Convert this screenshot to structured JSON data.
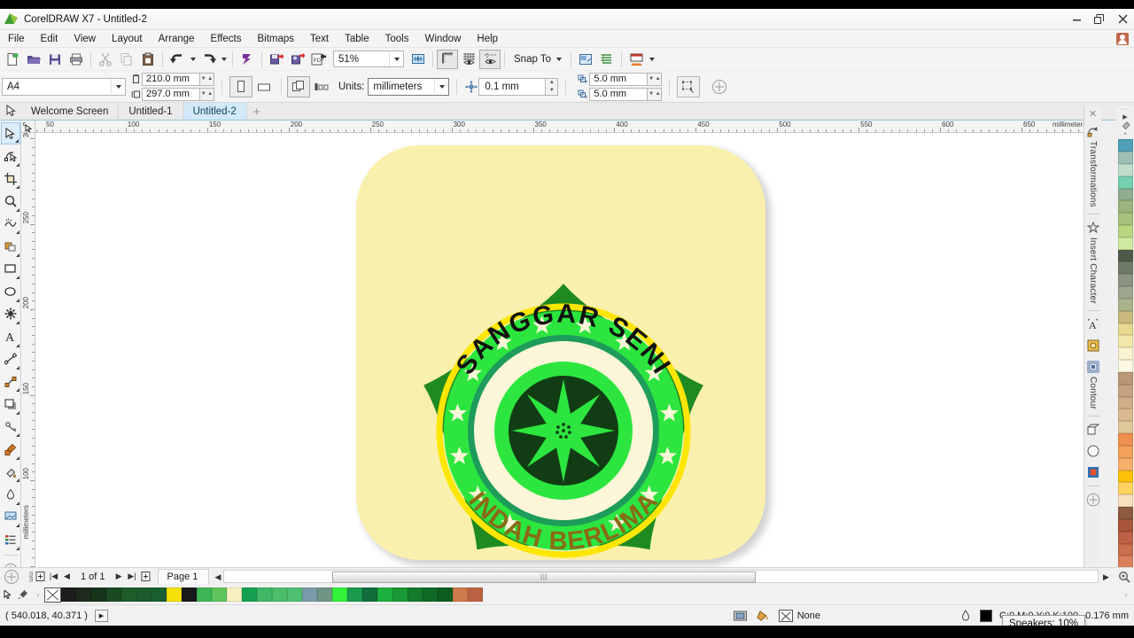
{
  "window": {
    "title": "CorelDRAW X7 - Untitled-2",
    "minimize": "–",
    "restore": "❐",
    "close": "✕"
  },
  "menu": {
    "items": [
      "File",
      "Edit",
      "View",
      "Layout",
      "Arrange",
      "Effects",
      "Bitmaps",
      "Text",
      "Table",
      "Tools",
      "Window",
      "Help"
    ]
  },
  "toolbar": {
    "new_label": "New",
    "open_label": "Open",
    "save_label": "Save",
    "print_label": "Print",
    "cut_label": "Cut",
    "copy_label": "Copy",
    "paste_label": "Paste",
    "undo_label": "Undo",
    "redo_label": "Redo",
    "import_label": "Import",
    "export_label": "Export",
    "publish_pdf_label": "Publish to PDF",
    "zoom_level": "51%",
    "snap_to": "Snap To",
    "options_label": "Options",
    "fullscreen_label": "Full-screen preview",
    "show_rulers_label": "Show Rulers",
    "show_grid_label": "Show Grid",
    "show_guides_label": "Show Guides",
    "application_launcher": "Application Launcher"
  },
  "property_bar": {
    "page_size": "A4",
    "page_width": "210.0 mm",
    "page_height": "297.0 mm",
    "portrait_label": "Portrait",
    "landscape_label": "Landscape",
    "all_pages_label": "All Pages",
    "current_page_label": "Current Page",
    "units_label": "Units:",
    "units_value": "millimeters",
    "nudge_value": "0.1 mm",
    "duplicate_x": "5.0 mm",
    "duplicate_y": "5.0 mm",
    "snap_label": "Snap to objects",
    "options_label": "Options"
  },
  "tabs": {
    "items": [
      {
        "label": "Welcome Screen",
        "active": false
      },
      {
        "label": "Untitled-1",
        "active": false
      },
      {
        "label": "Untitled-2",
        "active": true
      }
    ],
    "add_label": "+"
  },
  "toolbox": {
    "items": [
      {
        "name": "pick-tool",
        "label": "Pick",
        "selected": true
      },
      {
        "name": "shape-tool",
        "label": "Shape",
        "selected": false
      },
      {
        "name": "crop-tool",
        "label": "Crop",
        "selected": false
      },
      {
        "name": "zoom-tool",
        "label": "Zoom",
        "selected": false
      },
      {
        "name": "freehand-tool",
        "label": "Freehand",
        "selected": false
      },
      {
        "name": "smart-fill-tool",
        "label": "Smart Fill",
        "selected": false
      },
      {
        "name": "rectangle-tool",
        "label": "Rectangle",
        "selected": false
      },
      {
        "name": "ellipse-tool",
        "label": "Ellipse",
        "selected": false
      },
      {
        "name": "polygon-tool",
        "label": "Polygon",
        "selected": false
      },
      {
        "name": "text-tool",
        "label": "Text",
        "selected": false
      },
      {
        "name": "parallel-dimension-tool",
        "label": "Parallel Dimension",
        "selected": false
      },
      {
        "name": "straight-line-connector-tool",
        "label": "Straight-Line Connector",
        "selected": false
      },
      {
        "name": "drop-shadow-tool",
        "label": "Drop Shadow",
        "selected": false
      },
      {
        "name": "transparency-tool",
        "label": "Transparency",
        "selected": false
      },
      {
        "name": "color-eyedropper-tool",
        "label": "Color Eyedropper",
        "selected": false
      },
      {
        "name": "interactive-fill-tool",
        "label": "Interactive Fill",
        "selected": false
      },
      {
        "name": "outline-tool",
        "label": "Outline",
        "selected": false
      },
      {
        "name": "fill-tool",
        "label": "Fill",
        "selected": false
      },
      {
        "name": "object-properties-tool",
        "label": "Object Properties",
        "selected": false
      }
    ]
  },
  "rulers": {
    "units": "millimeters",
    "horizontal_ticks": [
      50,
      100,
      150,
      200,
      250,
      300,
      350,
      400,
      450,
      500,
      550,
      600,
      650
    ],
    "vertical_ticks": [
      300,
      250,
      200,
      150,
      100
    ]
  },
  "artwork": {
    "title": "Sanggar Seni Indah Berlima logo",
    "text_top": "SANGGAR SENI",
    "text_bottom": "INDAH BERLIMA",
    "star_count": 14,
    "colors": {
      "background": "#faf0ae",
      "petal_dark_green": "#1f8a22",
      "ring_yellow": "#ffe600",
      "ring_bright_green": "#2ce63f",
      "ring_teal": "#1d9c5a",
      "inner_cream": "#fdf6d8",
      "center_dark": "#123d14",
      "text_top_color": "#111111",
      "text_bottom_color": "#8a6a16",
      "star_fill": "#fdf6d8"
    }
  },
  "page_nav": {
    "first_label": "|◀",
    "prev_label": "◀",
    "counter": "1 of 1",
    "next_label": "▶",
    "last_label": "▶|",
    "add_page_label": "+",
    "page_tab": "Page 1"
  },
  "palette": {
    "bottom_colors": [
      "#1c1c1c",
      "#1e2b1c",
      "#15341a",
      "#1a4a22",
      "#1e5c2a",
      "#1c5c2c",
      "#186030",
      "#f5e006",
      "#17191a",
      "#3eb557",
      "#5ec45c",
      "#f8f0c0",
      "#16a152",
      "#3fb866",
      "#4cbd6a",
      "#4ec073",
      "#7b9aa8",
      "#6f9684",
      "#33f23a",
      "#1b9a4e",
      "#0f6e3c",
      "#1cb23e",
      "#1a9a36",
      "#147a2c",
      "#0f6b25",
      "#0d5c20",
      "#cf7a4a",
      "#bc6244"
    ],
    "right_colors": [
      "#4fa0b8",
      "#9dbfb6",
      "#bedcc8",
      "#76cfae",
      "#8fae8f",
      "#9bb37d",
      "#a7c07b",
      "#b8d77e",
      "#cfe9a1",
      "#4f5a4a",
      "#6f7a68",
      "#8b9483",
      "#9ca68e",
      "#aab38c",
      "#c7b97c",
      "#e6d98d",
      "#f2e7a8",
      "#faf3cf",
      "#fdf8e0",
      "#b99877",
      "#c6a27f",
      "#d0ae8a",
      "#d9b98f",
      "#e0c79a",
      "#ef8f4d",
      "#f2a05a",
      "#f5b06a",
      "#ffc107",
      "#ffd45e",
      "#f8e0bd",
      "#8d5a3f",
      "#a8543a",
      "#bd6045",
      "#c96f4d",
      "#d97f5a"
    ]
  },
  "docker": {
    "close_label": "✕",
    "tabs": [
      {
        "name": "transformations",
        "label": "Transformations"
      },
      {
        "name": "insert-character",
        "label": "Insert Character"
      },
      {
        "name": "contour",
        "label": "Contour"
      }
    ]
  },
  "statusbar": {
    "coordinates": "( 540.018, 40.371 )",
    "coord_toggle": "▶",
    "fill_none": "None",
    "outline_color": "C:0 M:0 Y:0 K:100",
    "outline_width": "0.176 mm"
  },
  "tooltip": {
    "text": "Speakers: 10%"
  }
}
